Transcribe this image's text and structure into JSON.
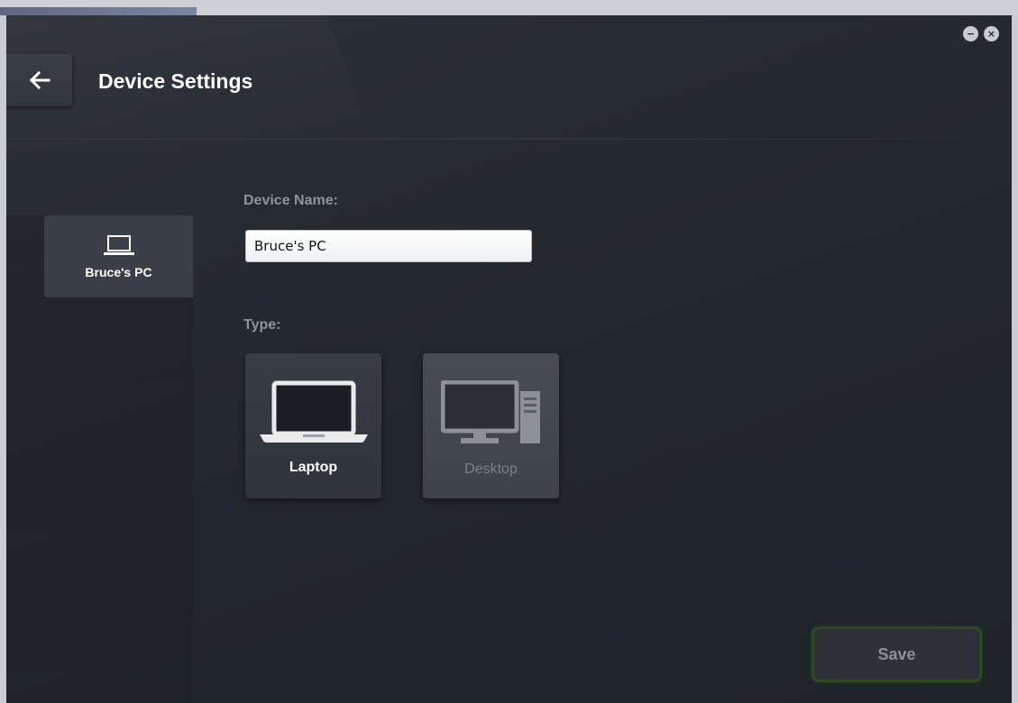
{
  "window": {
    "minimize_symbol": "−",
    "close_symbol": "×"
  },
  "header": {
    "back_icon": "arrow-left-icon",
    "title": "Device Settings"
  },
  "sidebar": {
    "devices": [
      {
        "label": "Bruce's PC",
        "icon": "laptop-icon",
        "selected": true
      }
    ]
  },
  "form": {
    "device_name_label": "Device Name:",
    "device_name_value": "Bruce's PC",
    "type_label": "Type:",
    "types": [
      {
        "label": "Laptop",
        "icon": "laptop-icon",
        "selected": true
      },
      {
        "label": "Desktop",
        "icon": "desktop-icon",
        "selected": false
      }
    ],
    "save_label": "Save"
  },
  "colors": {
    "background": "#23272e",
    "save_border": "#2e4a22"
  }
}
